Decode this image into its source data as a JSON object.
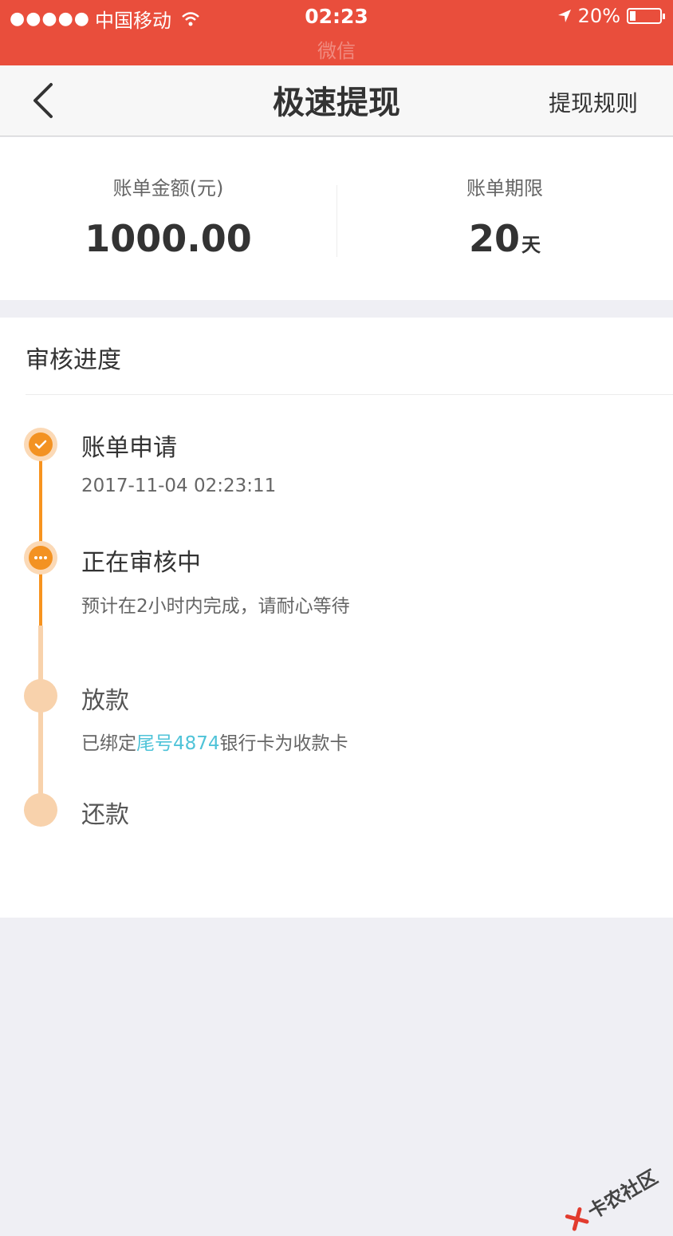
{
  "status_bar": {
    "signal_dots": "●●●●●",
    "carrier": "中国移动",
    "time": "02:23",
    "sub_title": "微信",
    "battery": "20%"
  },
  "nav": {
    "title": "极速提现",
    "action": "提现规则"
  },
  "summary": {
    "amount_label": "账单金额(元)",
    "amount_value": "1000.00",
    "term_label": "账单期限",
    "term_value": "20",
    "term_unit": "天"
  },
  "progress": {
    "title": "审核进度",
    "steps": [
      {
        "title": "账单申请",
        "sub": "2017-11-04 02:23:11",
        "state": "done"
      },
      {
        "title": "正在审核中",
        "sub": "预计在2小时内完成，请耐心等待",
        "state": "current"
      },
      {
        "title": "放款",
        "sub_prefix": "已绑定",
        "sub_highlight": "尾号4874",
        "sub_suffix": "银行卡为收款卡",
        "state": "pending"
      },
      {
        "title": "还款",
        "state": "pending"
      }
    ]
  },
  "watermark": {
    "text": "卡农社区"
  },
  "colors": {
    "status_bar": "#e94e3c",
    "accent_orange": "#f39222",
    "pending_orange": "#f8d2ac",
    "highlight_blue": "#4fc3d8"
  }
}
